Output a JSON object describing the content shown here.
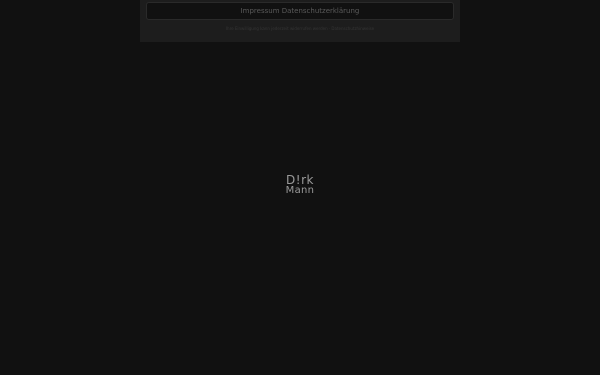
{
  "consent": {
    "button_label": "Impressum Datenschutzerklärung",
    "note": "Ihre Einwilligung kann jederzeit widerrufen werden · Datenschutzhinweise"
  },
  "logo": {
    "line1": "D!rk",
    "line2": "Mann"
  },
  "colors": {
    "background": "#111111",
    "panel": "#1d1d1d",
    "logo_text": "#9a9a9a"
  }
}
